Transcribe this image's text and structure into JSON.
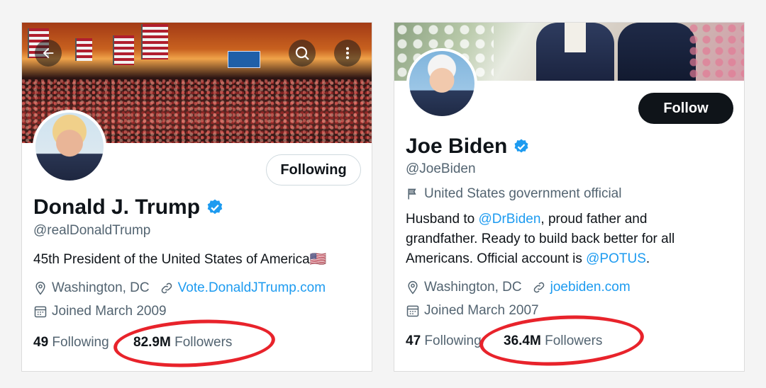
{
  "trump": {
    "name": "Donald J. Trump",
    "handle": "@realDonaldTrump",
    "bio": "45th President of the United States of America🇺🇸",
    "location": "Washington, DC",
    "website": "Vote.DonaldJTrump.com",
    "joined": "Joined March 2009",
    "following_count": "49",
    "following_label": "Following",
    "followers_count": "82.9M",
    "followers_label": "Followers",
    "action_button": "Following"
  },
  "biden": {
    "name": "Joe Biden",
    "handle": "@JoeBiden",
    "label": "United States government official",
    "bio_prefix": "Husband to ",
    "bio_link1": "@DrBiden",
    "bio_mid": ", proud father and grandfather. Ready to build back better for all Americans. Official account is ",
    "bio_link2": "@POTUS",
    "bio_suffix": ".",
    "location": "Washington, DC",
    "website": "joebiden.com",
    "joined": "Joined March 2007",
    "following_count": "47",
    "following_label": "Following",
    "followers_count": "36.4M",
    "followers_label": "Followers",
    "action_button": "Follow"
  },
  "icons": {
    "verified": "verified-badge-icon",
    "location": "location-pin-icon",
    "link": "link-icon",
    "calendar": "calendar-icon",
    "flag": "flag-icon",
    "bell": "notification-bell-icon",
    "back": "back-arrow-icon",
    "search": "search-icon",
    "more": "more-vertical-icon"
  },
  "colors": {
    "link_blue": "#1d9bf0",
    "verified_blue": "#1d9bf0",
    "annotation_red": "#e8232b",
    "text_primary": "#0f1419",
    "text_secondary": "#536471"
  }
}
